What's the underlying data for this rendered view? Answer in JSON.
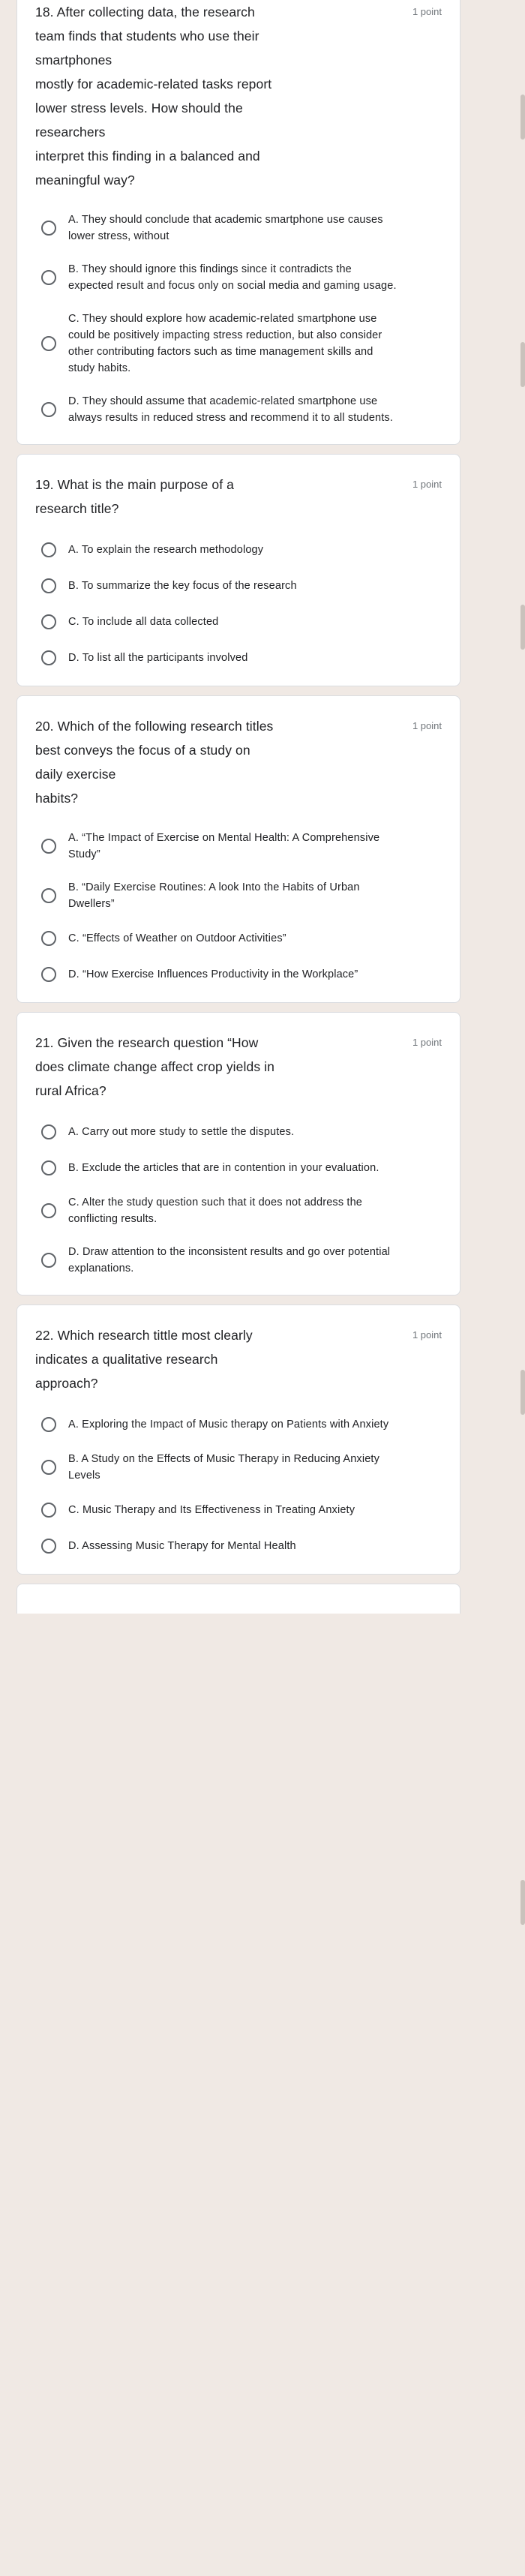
{
  "meta": {
    "points_label": "1 point",
    "accent_color": "#202124",
    "page_background": "#F0E9E4",
    "card_background": "#FFFFFF",
    "muted_text_color": "#70757a"
  },
  "questions": [
    {
      "id": "q18",
      "title": "18. After collecting data, the research\nteam finds that students who use their\nsmartphones\nmostly for academic-related tasks report\nlower stress levels. How should the\nresearchers\ninterpret this finding in a balanced and\nmeaningful way?",
      "points": "1 point",
      "options": [
        {
          "id": "q18a",
          "label": "A. They should conclude that academic smartphone use causes lower stress, without"
        },
        {
          "id": "q18b",
          "label": "B. They should ignore this findings since it contradicts the expected result and focus only on social media and gaming usage."
        },
        {
          "id": "q18c",
          "label": "C. They should explore how academic-related smartphone use could be positively impacting stress reduction, but also consider other contributing factors such as time management skills and study habits."
        },
        {
          "id": "q18d",
          "label": "D. They should assume that academic-related smartphone use always results in reduced stress and recommend it to all students."
        }
      ]
    },
    {
      "id": "q19",
      "title": "19. What is the main purpose of a\nresearch title?",
      "points": "1 point",
      "options": [
        {
          "id": "q19a",
          "label": "A. To explain the research methodology"
        },
        {
          "id": "q19b",
          "label": "B. To summarize the key focus of the research"
        },
        {
          "id": "q19c",
          "label": "C. To include all data collected"
        },
        {
          "id": "q19d",
          "label": "D. To list all the participants involved"
        }
      ]
    },
    {
      "id": "q20",
      "title": "20. Which of the following research titles\nbest conveys the focus of a study on\ndaily exercise\nhabits?",
      "points": "1 point",
      "options": [
        {
          "id": "q20a",
          "label": "A. “The Impact of Exercise on Mental Health: A Comprehensive Study”"
        },
        {
          "id": "q20b",
          "label": "B. “Daily Exercise Routines: A look Into the Habits of Urban Dwellers”"
        },
        {
          "id": "q20c",
          "label": "C. “Effects of Weather on Outdoor Activities”"
        },
        {
          "id": "q20d",
          "label": "D. “How Exercise Influences Productivity in the Workplace”"
        }
      ]
    },
    {
      "id": "q21",
      "title": "21. Given the research question “How\ndoes climate change affect crop yields in\nrural Africa?",
      "points": "1 point",
      "options": [
        {
          "id": "q21a",
          "label": "A. Carry out more study to settle the disputes."
        },
        {
          "id": "q21b",
          "label": "B. Exclude the articles that are in contention in your evaluation."
        },
        {
          "id": "q21c",
          "label": "C. Alter the study question such that it does not address the conflicting results."
        },
        {
          "id": "q21d",
          "label": "D. Draw attention to the inconsistent results and go over potential explanations."
        }
      ]
    },
    {
      "id": "q22",
      "title": "22. Which research tittle most clearly\nindicates a qualitative research\napproach?",
      "points": "1 point",
      "options": [
        {
          "id": "q22a",
          "label": "A. Exploring the Impact of Music therapy on Patients with Anxiety"
        },
        {
          "id": "q22b",
          "label": "B. A Study on the Effects of Music Therapy in Reducing Anxiety Levels"
        },
        {
          "id": "q22c",
          "label": "C. Music Therapy and Its Effectiveness in Treating Anxiety"
        },
        {
          "id": "q22d",
          "label": "D. Assessing Music Therapy for Mental Health"
        }
      ]
    }
  ]
}
